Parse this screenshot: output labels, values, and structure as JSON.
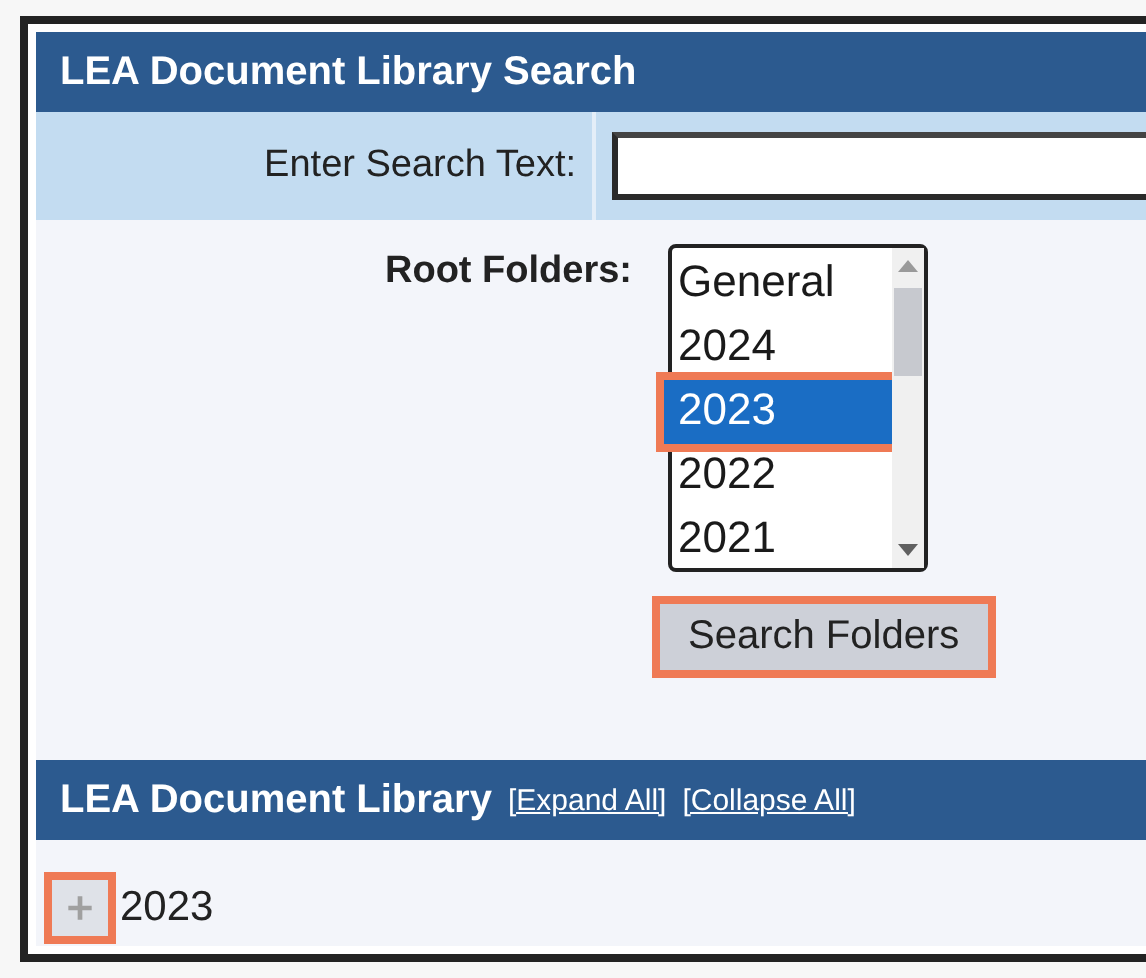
{
  "search_panel": {
    "title": "LEA Document Library Search",
    "search_label": "Enter Search Text:",
    "root_folders_label": "Root Folders:",
    "folders": [
      {
        "label": "General",
        "selected": false,
        "highlighted": false
      },
      {
        "label": "2024",
        "selected": false,
        "highlighted": false
      },
      {
        "label": "2023",
        "selected": true,
        "highlighted": true
      },
      {
        "label": "2022",
        "selected": false,
        "highlighted": false
      },
      {
        "label": "2021",
        "selected": false,
        "highlighted": false
      }
    ],
    "search_button": {
      "label": "Search Folders",
      "highlighted": true
    }
  },
  "library_panel": {
    "title": "LEA Document Library",
    "links": [
      "[Expand All]",
      "[Collapse All]"
    ],
    "tree": [
      {
        "label": "2023",
        "expanded": false,
        "toggle_highlighted": true
      }
    ]
  }
}
